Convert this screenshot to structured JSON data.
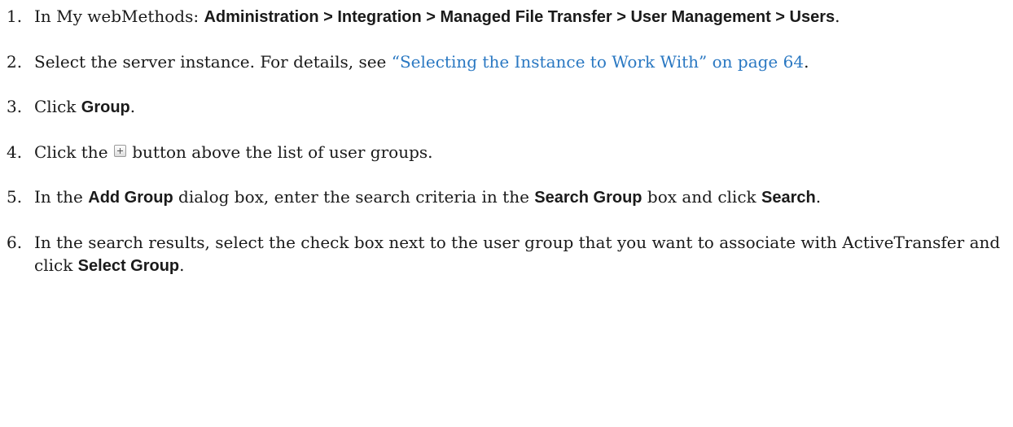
{
  "steps": [
    {
      "num": "1.",
      "parts": [
        {
          "t": "In My webMethods: "
        },
        {
          "t": "Administration > Integration > Managed File Transfer > User Management > Users",
          "ui": true
        },
        {
          "t": "."
        }
      ]
    },
    {
      "num": "2.",
      "parts": [
        {
          "t": "Select the server instance. For details, see "
        },
        {
          "t": "“Selecting the Instance to Work With” on page 64",
          "link": true
        },
        {
          "t": "."
        }
      ]
    },
    {
      "num": "3.",
      "parts": [
        {
          "t": "Click "
        },
        {
          "t": "Group",
          "ui": true
        },
        {
          "t": "."
        }
      ]
    },
    {
      "num": "4.",
      "parts": [
        {
          "t": "Click the "
        },
        {
          "icon": "plus-button-icon"
        },
        {
          "t": " button above the list of user groups."
        }
      ]
    },
    {
      "num": "5.",
      "parts": [
        {
          "t": "In the "
        },
        {
          "t": "Add Group",
          "ui": true
        },
        {
          "t": " dialog box, enter the search criteria in the "
        },
        {
          "t": "Search Group",
          "ui": true
        },
        {
          "t": " box and click "
        },
        {
          "t": "Search",
          "ui": true
        },
        {
          "t": "."
        }
      ]
    },
    {
      "num": "6.",
      "parts": [
        {
          "t": "In the search results, select the check box next to the user group that you want to associate with ActiveTransfer and click "
        },
        {
          "t": "Select Group",
          "ui": true
        },
        {
          "t": "."
        }
      ]
    }
  ]
}
